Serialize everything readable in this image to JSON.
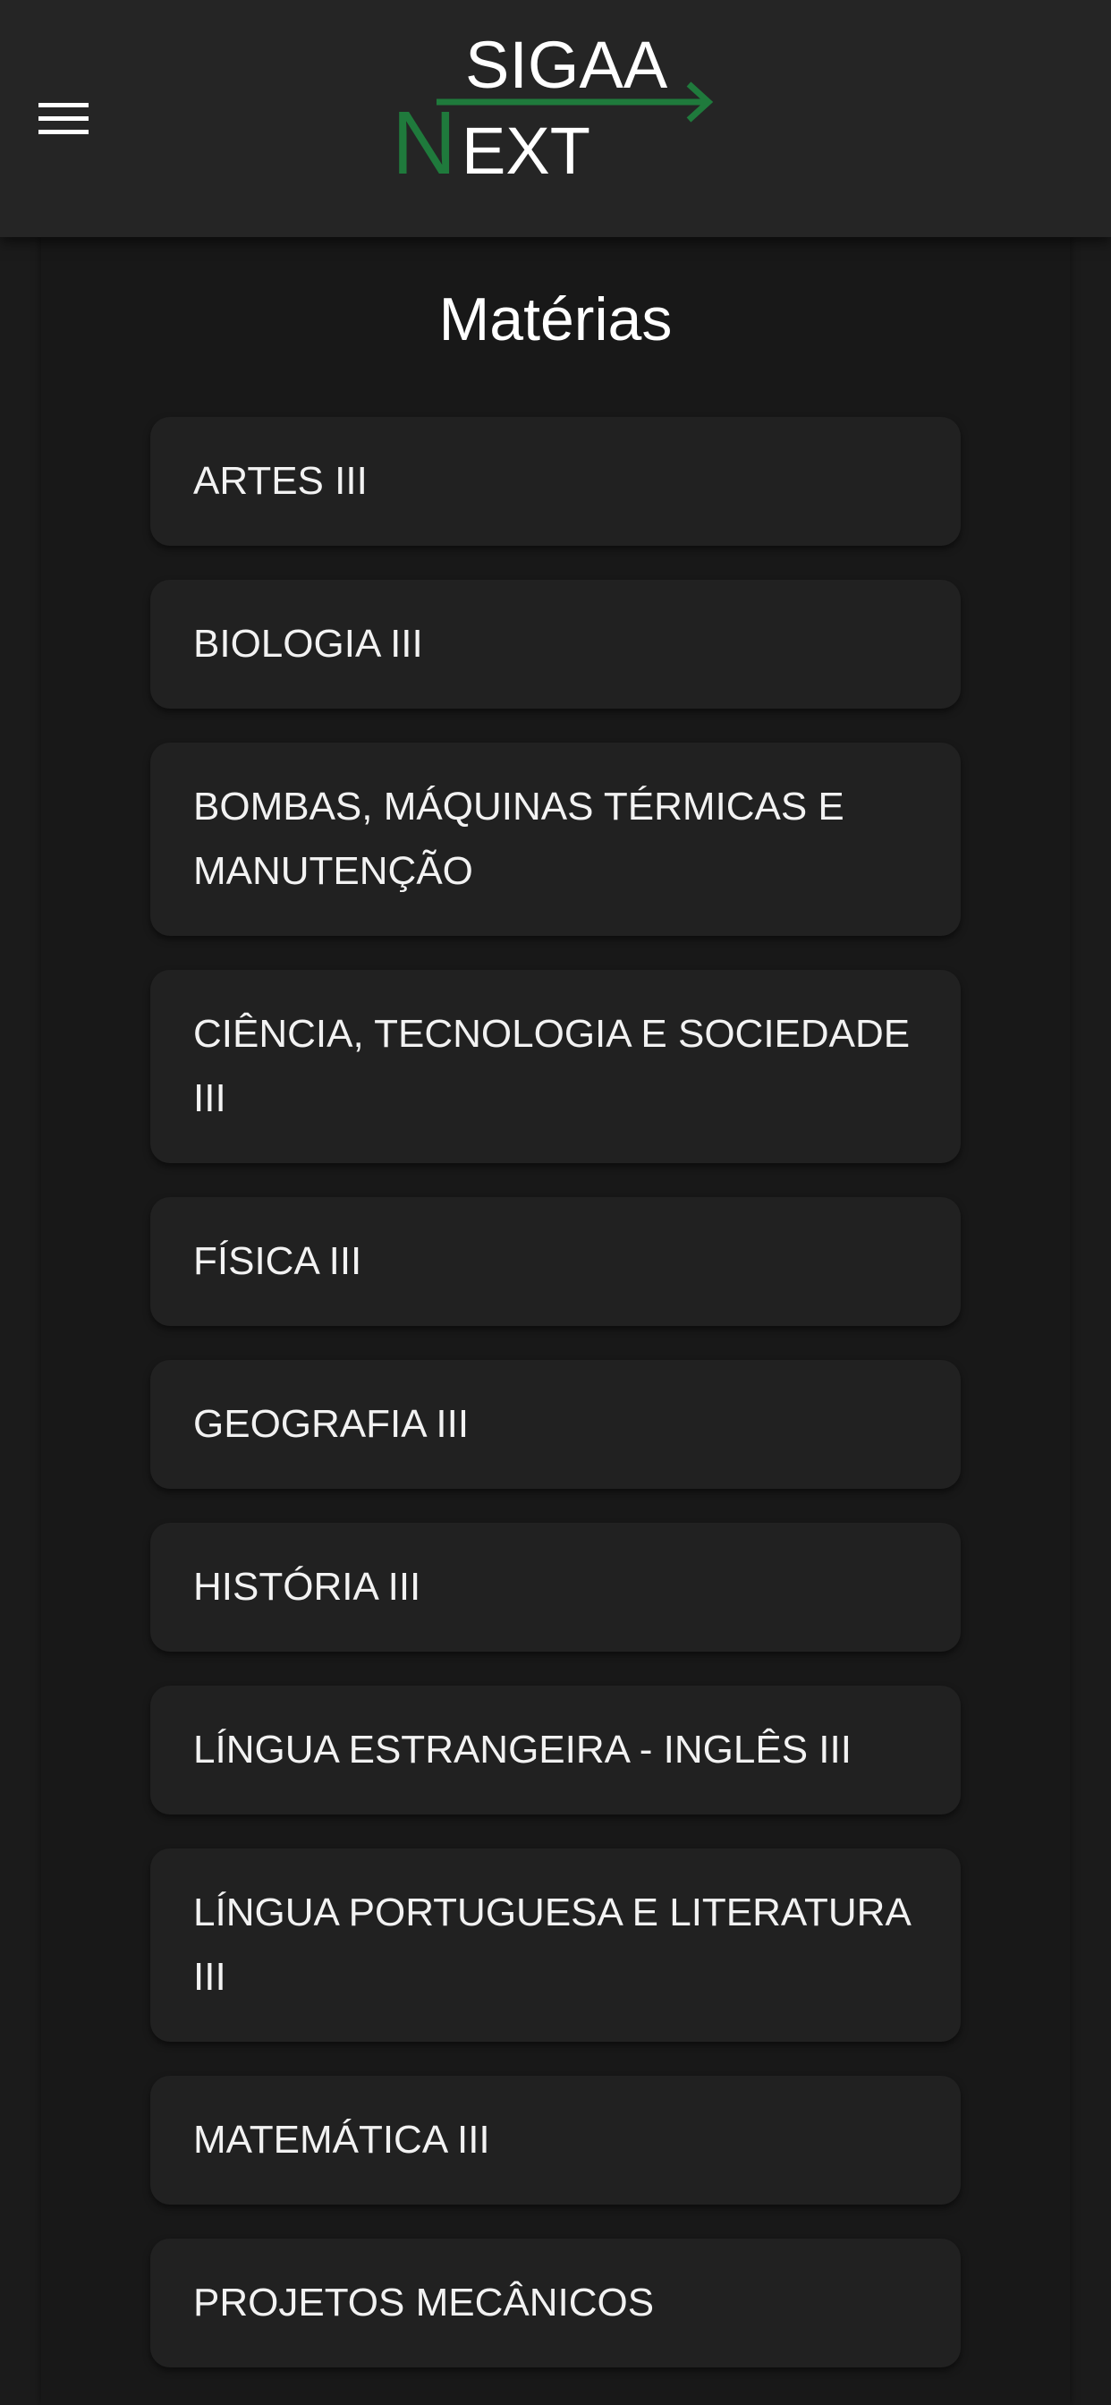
{
  "app": {
    "logo_top": "SIGAA",
    "logo_letter": "N",
    "logo_bottom": "EXT",
    "accent_color": "#1f7a3c",
    "menu_icon": "hamburger-menu-icon"
  },
  "page": {
    "title": "Matérias"
  },
  "subjects": [
    {
      "label": "ARTES III"
    },
    {
      "label": "BIOLOGIA III"
    },
    {
      "label": "BOMBAS, MÁQUINAS TÉRMICAS E MANUTENÇÃO"
    },
    {
      "label": "CIÊNCIA, TECNOLOGIA E SOCIEDADE III"
    },
    {
      "label": "FÍSICA III"
    },
    {
      "label": "GEOGRAFIA III"
    },
    {
      "label": "HISTÓRIA III"
    },
    {
      "label": "LÍNGUA ESTRANGEIRA - INGLÊS III"
    },
    {
      "label": "LÍNGUA PORTUGUESA E LITERATURA III"
    },
    {
      "label": "MATEMÁTICA III"
    },
    {
      "label": "PROJETOS MECÂNICOS"
    }
  ]
}
